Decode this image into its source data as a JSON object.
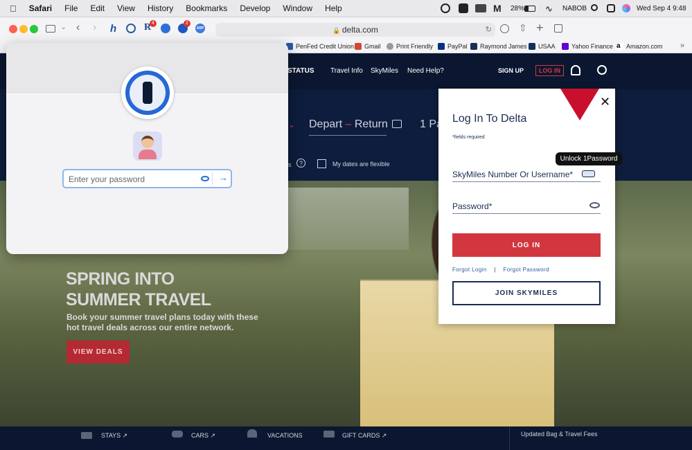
{
  "menubar": {
    "apple_icon": "apple-icon",
    "app": "Safari",
    "menus": [
      "File",
      "Edit",
      "View",
      "History",
      "Bookmarks",
      "Develop",
      "Window",
      "Help"
    ],
    "battery": "28%",
    "network": "NABOB",
    "datetime": "Wed Sep 4  9:48"
  },
  "toolbar": {
    "url": "delta.com",
    "badge_r": "4",
    "badge_p": "2",
    "abp": "ABP"
  },
  "bookmarks": [
    "PenFed Credit Union",
    "Gmail",
    "Print Friendly",
    "PayPal",
    "Raymond James",
    "USAA",
    "Yahoo Finance",
    "Amazon.com"
  ],
  "site": {
    "nav": {
      "status": "STATUS",
      "travel_info": "Travel Info",
      "skymiles": "SkyMiles",
      "need_help": "Need Help?",
      "sign_up": "SIGN UP",
      "log_in": "LOG IN"
    },
    "search": {
      "depart": "Depart",
      "return": "Return",
      "pax": "1 Pa",
      "flexible": "My dates are flexible",
      "shop_with": "es"
    },
    "hero": {
      "title_line1": "SPRING INTO",
      "title_line2": "SUMMER TRAVEL",
      "subtitle_line1": "Book your summer travel plans today with these",
      "subtitle_line2": "hot travel deals across our entire network.",
      "cta": "VIEW DEALS"
    },
    "footer": {
      "stays": "STAYS ↗",
      "cars": "CARS ↗",
      "vacations": "VACATIONS",
      "gift_cards": "GIFT CARDS ↗",
      "bag_fees": "Updated Bag & Travel Fees"
    }
  },
  "onepassword": {
    "password_placeholder": "Enter your password"
  },
  "login": {
    "title": "Log In To Delta",
    "required": "*fields required",
    "username_label": "SkyMiles Number Or Username*",
    "password_label": "Password*",
    "login_button": "LOG IN",
    "forgot_login": "Forgot Login",
    "separator": "|",
    "forgot_password": "Forgot Password",
    "join_button": "JOIN SKYMILES",
    "tooltip": "Unlock 1Password"
  },
  "colors": {
    "delta_red": "#c8102e",
    "login_red": "#d2373f",
    "navy": "#0b1730",
    "onepass_blue": "#1a6fd6"
  }
}
